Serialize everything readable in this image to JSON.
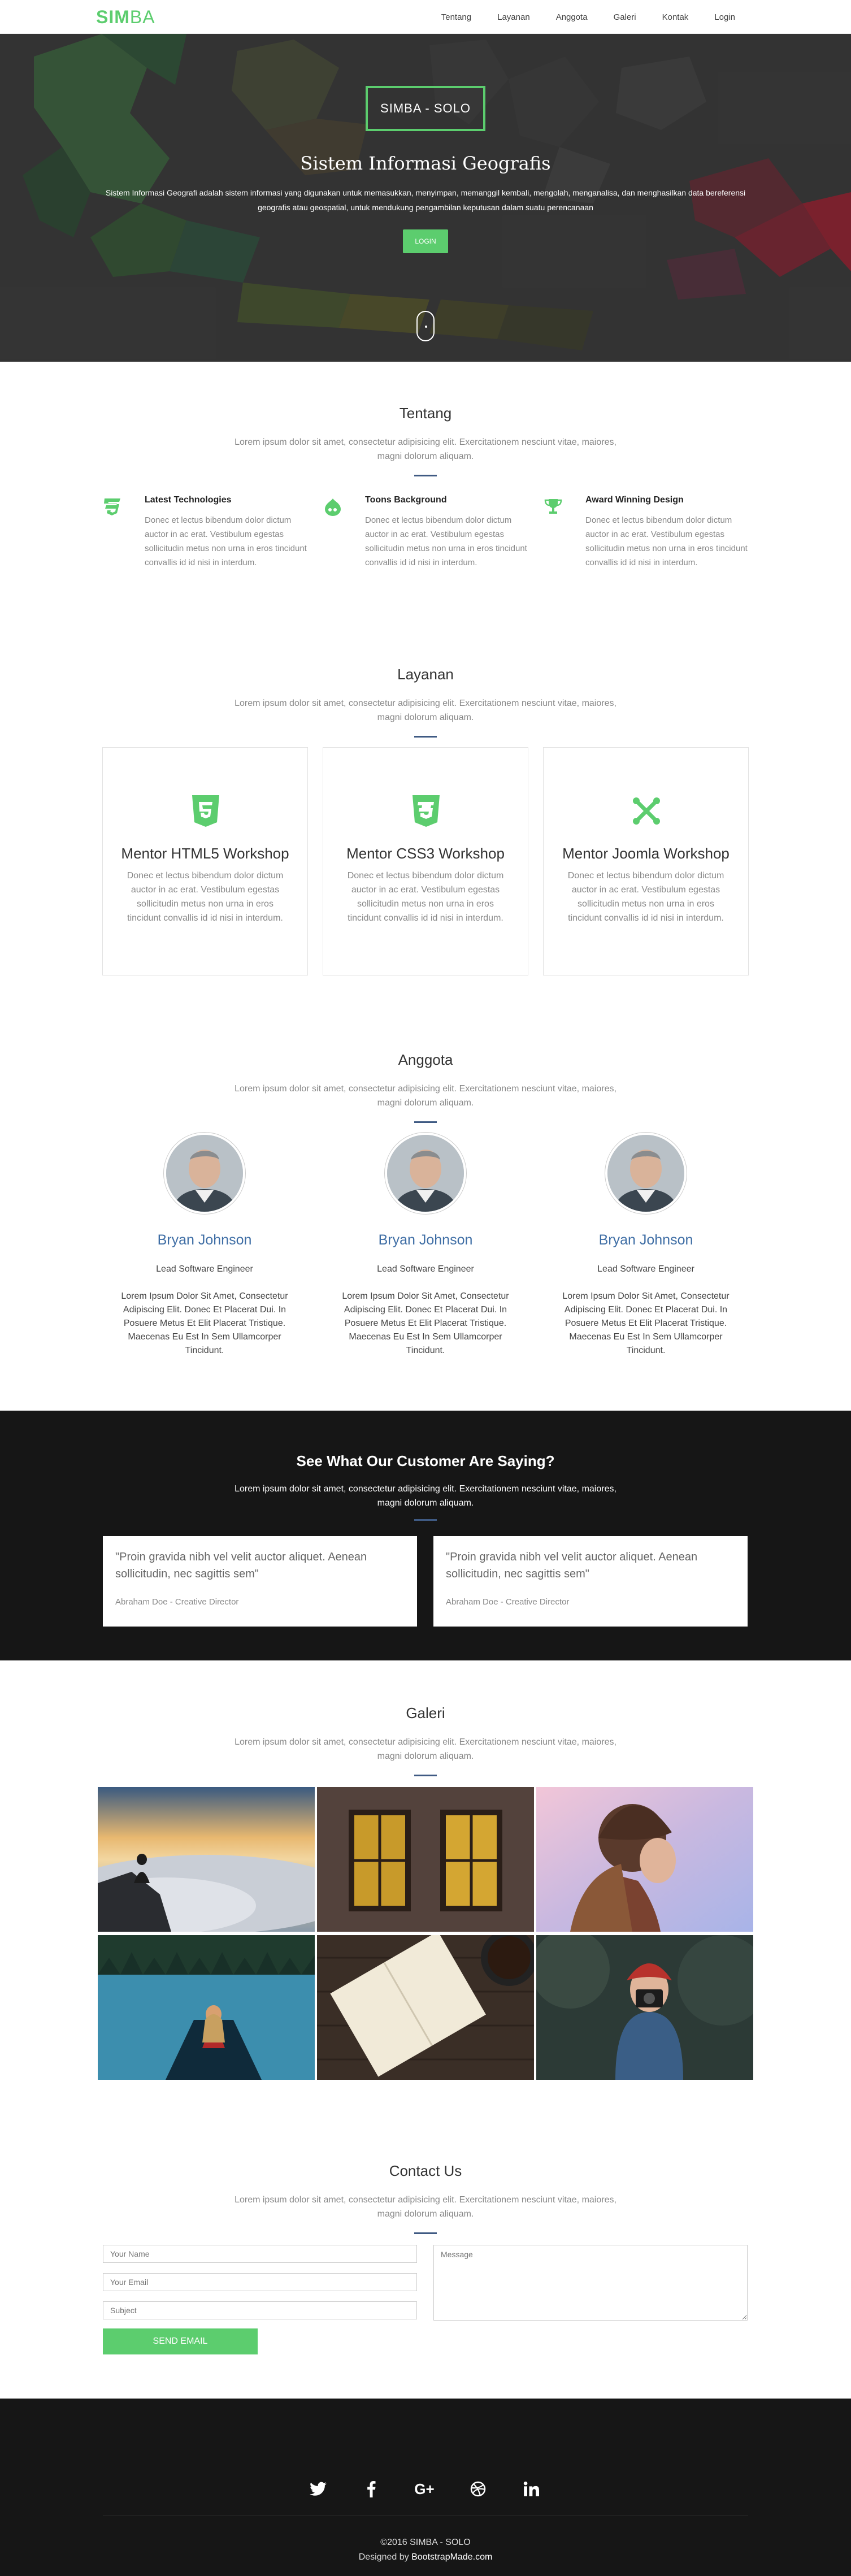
{
  "nav": {
    "brand_part1": "SIM",
    "brand_part2": "BA",
    "links": [
      "Tentang",
      "Layanan",
      "Anggota",
      "Galeri",
      "Kontak",
      "Login"
    ]
  },
  "hero": {
    "badge": "SIMBA - SOLO",
    "title": "Sistem Informasi Geografis",
    "description": "Sistem Informasi Geografi adalah sistem informasi yang digunakan untuk memasukkan, menyimpan, memanggil kembali, mengolah, menganalisa, dan menghasilkan data bereferensi geografis atau geospatial, untuk mendukung pengambilan keputusan dalam suatu perencanaan",
    "button": "LOGIN"
  },
  "tentang": {
    "title": "Tentang",
    "subtitle": "Lorem ipsum dolor sit amet, consectetur adipisicing elit. Exercitationem nesciunt vitae, maiores, magni dolorum aliquam.",
    "features": [
      {
        "icon": "css3-icon",
        "title": "Latest Technologies",
        "text": "Donec et lectus bibendum dolor dictum auctor in ac erat. Vestibulum egestas sollicitudin metus non urna in eros tincidunt convallis id id nisi in interdum."
      },
      {
        "icon": "drupal-icon",
        "title": "Toons Background",
        "text": "Donec et lectus bibendum dolor dictum auctor in ac erat. Vestibulum egestas sollicitudin metus non urna in eros tincidunt convallis id id nisi in interdum."
      },
      {
        "icon": "trophy-icon",
        "title": "Award Winning Design",
        "text": "Donec et lectus bibendum dolor dictum auctor in ac erat. Vestibulum egestas sollicitudin metus non urna in eros tincidunt convallis id id nisi in interdum."
      }
    ]
  },
  "layanan": {
    "title": "Layanan",
    "subtitle": "Lorem ipsum dolor sit amet, consectetur adipisicing elit. Exercitationem nesciunt vitae, maiores, magni dolorum aliquam.",
    "services": [
      {
        "icon": "html5-icon",
        "title": "Mentor HTML5 Workshop",
        "text": "Donec et lectus bibendum dolor dictum auctor in ac erat. Vestibulum egestas sollicitudin metus non urna in eros tincidunt convallis id id nisi in interdum."
      },
      {
        "icon": "css3-icon",
        "title": "Mentor CSS3 Workshop",
        "text": "Donec et lectus bibendum dolor dictum auctor in ac erat. Vestibulum egestas sollicitudin metus non urna in eros tincidunt convallis id id nisi in interdum."
      },
      {
        "icon": "joomla-icon",
        "title": "Mentor Joomla Workshop",
        "text": "Donec et lectus bibendum dolor dictum auctor in ac erat. Vestibulum egestas sollicitudin metus non urna in eros tincidunt convallis id id nisi in interdum."
      }
    ]
  },
  "anggota": {
    "title": "Anggota",
    "subtitle": "Lorem ipsum dolor sit amet, consectetur adipisicing elit. Exercitationem nesciunt vitae, maiores, magni dolorum aliquam.",
    "members": [
      {
        "name": "Bryan Johnson",
        "role": "Lead Software Engineer",
        "bio": "Lorem Ipsum Dolor Sit Amet, Consectetur Adipiscing Elit. Donec Et Placerat Dui. In Posuere Metus Et Elit Placerat Tristique. Maecenas Eu Est In Sem Ullamcorper Tincidunt."
      },
      {
        "name": "Bryan Johnson",
        "role": "Lead Software Engineer",
        "bio": "Lorem Ipsum Dolor Sit Amet, Consectetur Adipiscing Elit. Donec Et Placerat Dui. In Posuere Metus Et Elit Placerat Tristique. Maecenas Eu Est In Sem Ullamcorper Tincidunt."
      },
      {
        "name": "Bryan Johnson",
        "role": "Lead Software Engineer",
        "bio": "Lorem Ipsum Dolor Sit Amet, Consectetur Adipiscing Elit. Donec Et Placerat Dui. In Posuere Metus Et Elit Placerat Tristique. Maecenas Eu Est In Sem Ullamcorper Tincidunt."
      }
    ]
  },
  "testimonials": {
    "title": "See What Our Customer Are Saying?",
    "subtitle": "Lorem ipsum dolor sit amet, consectetur adipisicing elit. Exercitationem nesciunt vitae, maiores, magni dolorum aliquam.",
    "items": [
      {
        "quote": "\"Proin gravida nibh vel velit auctor aliquet. Aenean sollicitudin, nec sagittis sem\"",
        "author": "Abraham Doe - Creative Director"
      },
      {
        "quote": "\"Proin gravida nibh vel velit auctor aliquet. Aenean sollicitudin, nec sagittis sem\"",
        "author": "Abraham Doe - Creative Director"
      }
    ]
  },
  "galeri": {
    "title": "Galeri",
    "subtitle": "Lorem ipsum dolor sit amet, consectetur adipisicing elit. Exercitationem nesciunt vitae, maiores, magni dolorum aliquam."
  },
  "contact": {
    "title": "Contact Us",
    "subtitle": "Lorem ipsum dolor sit amet, consectetur adipisicing elit. Exercitationem nesciunt vitae, maiores, magni dolorum aliquam.",
    "name_placeholder": "Your Name",
    "email_placeholder": "Your Email",
    "subject_placeholder": "Subject",
    "message_placeholder": "Message",
    "send": "SEND EMAIL"
  },
  "footer": {
    "social": [
      "twitter-icon",
      "facebook-icon",
      "google-plus-icon",
      "dribbble-icon",
      "linkedin-icon"
    ],
    "copyright": "©2016 SIMBA - SOLO",
    "designed_by": "Designed by",
    "designer": "BootstrapMade.com"
  },
  "colors": {
    "accent": "#5ccd6e",
    "divider": "#3f5a83",
    "member_name": "#3f6ea5",
    "dark_bg": "#161616"
  }
}
